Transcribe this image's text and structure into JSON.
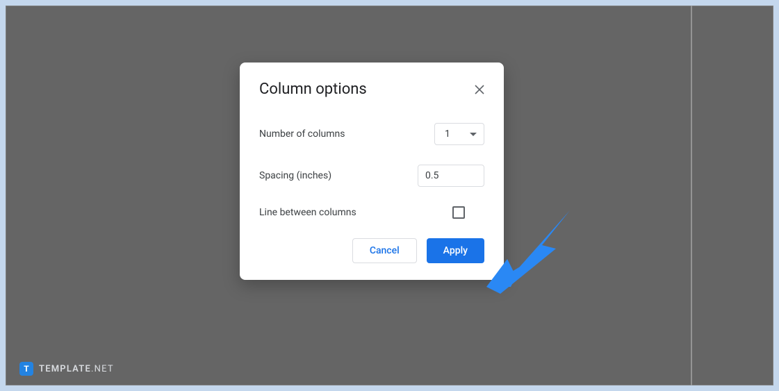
{
  "dialog": {
    "title": "Column options",
    "rows": {
      "number_label": "Number of columns",
      "number_value": "1",
      "spacing_label": "Spacing (inches)",
      "spacing_value": "0.5",
      "line_label": "Line between columns",
      "line_checked": false
    },
    "buttons": {
      "cancel": "Cancel",
      "apply": "Apply"
    }
  },
  "watermark": {
    "badge_letter": "T",
    "text_bold": "TEMPLATE",
    "text_light": ".NET"
  },
  "colors": {
    "accent": "#1a73e8",
    "arrow": "#2a88f4"
  }
}
